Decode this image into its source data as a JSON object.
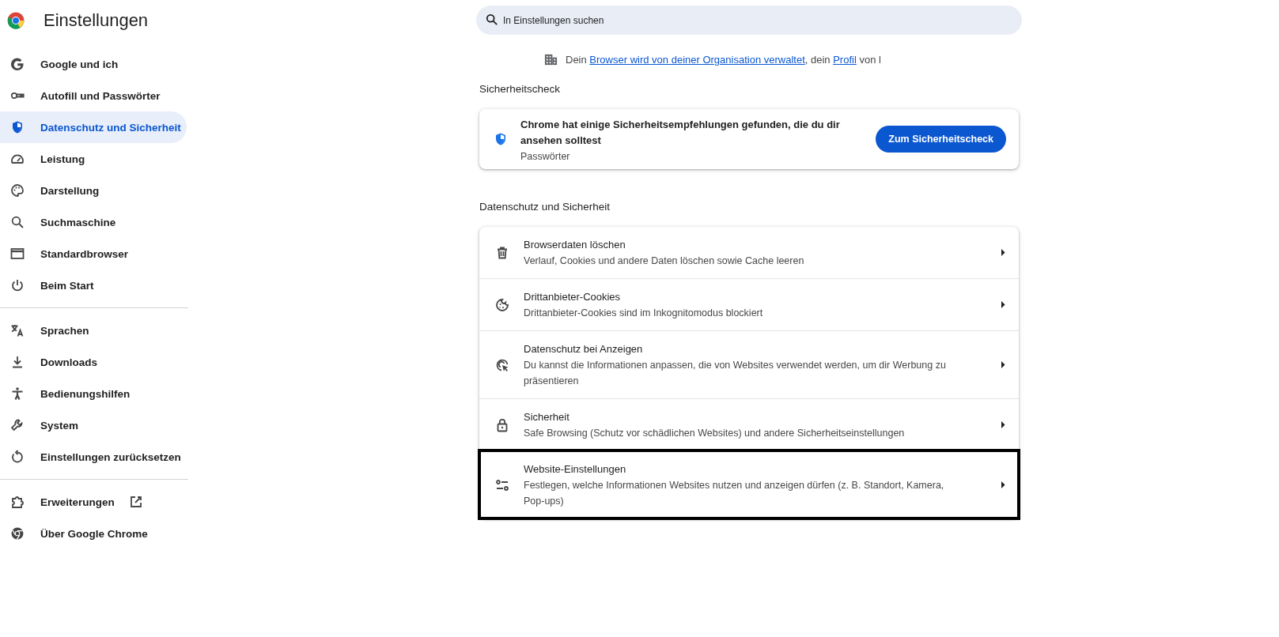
{
  "app": {
    "title": "Einstellungen"
  },
  "sidebar": {
    "groups": [
      [
        {
          "label": "Google und ich",
          "selected": false
        },
        {
          "label": "Autofill und Passwörter",
          "selected": false
        },
        {
          "label": "Datenschutz und Sicherheit",
          "selected": true
        },
        {
          "label": "Leistung",
          "selected": false
        },
        {
          "label": "Darstellung",
          "selected": false
        },
        {
          "label": "Suchmaschine",
          "selected": false
        },
        {
          "label": "Standardbrowser",
          "selected": false
        },
        {
          "label": "Beim Start",
          "selected": false
        }
      ],
      [
        {
          "label": "Sprachen",
          "selected": false
        },
        {
          "label": "Downloads",
          "selected": false
        },
        {
          "label": "Bedienungshilfen",
          "selected": false
        },
        {
          "label": "System",
          "selected": false
        },
        {
          "label": "Einstellungen zurücksetzen",
          "selected": false
        }
      ],
      [
        {
          "label": "Erweiterungen",
          "selected": false,
          "external": true
        },
        {
          "label": "Über Google Chrome",
          "selected": false
        }
      ]
    ]
  },
  "search": {
    "placeholder": "In Einstellungen suchen"
  },
  "managed_notice": [
    {
      "kind": "text",
      "text": "Dein "
    },
    {
      "kind": "link",
      "text": "Browser wird von deiner Organisation verwaltet"
    },
    {
      "kind": "text",
      "text": ", dein "
    },
    {
      "kind": "link",
      "text": "Profil"
    },
    {
      "kind": "text",
      "text": " von l"
    }
  ],
  "safety_check": {
    "heading": "Sicherheitscheck",
    "message": "Chrome hat einige Sicherheitsempfehlungen gefunden, die du dir ansehen solltest",
    "detail": "Passwörter",
    "button": "Zum Sicherheitscheck"
  },
  "privacy": {
    "heading": "Datenschutz und Sicherheit",
    "rows": [
      {
        "title": "Browserdaten löschen",
        "subtitle": "Verlauf, Cookies und andere Daten löschen sowie Cache leeren",
        "highlighted": false
      },
      {
        "title": "Drittanbieter-Cookies",
        "subtitle": "Drittanbieter-Cookies sind im Inkognitomodus blockiert",
        "highlighted": false
      },
      {
        "title": "Datenschutz bei Anzeigen",
        "subtitle": "Du kannst die Informationen anpassen, die von Websites verwendet werden, um dir Werbung zu präsentieren",
        "highlighted": false
      },
      {
        "title": "Sicherheit",
        "subtitle": "Safe Browsing (Schutz vor schädlichen Websites) und andere Sicherheitseinstellungen",
        "highlighted": false
      },
      {
        "title": "Website-Einstellungen",
        "subtitle": "Festlegen, welche Informationen Websites nutzen und anzeigen dürfen (z. B. Standort, Kamera, Pop-ups)",
        "highlighted": true
      }
    ]
  }
}
